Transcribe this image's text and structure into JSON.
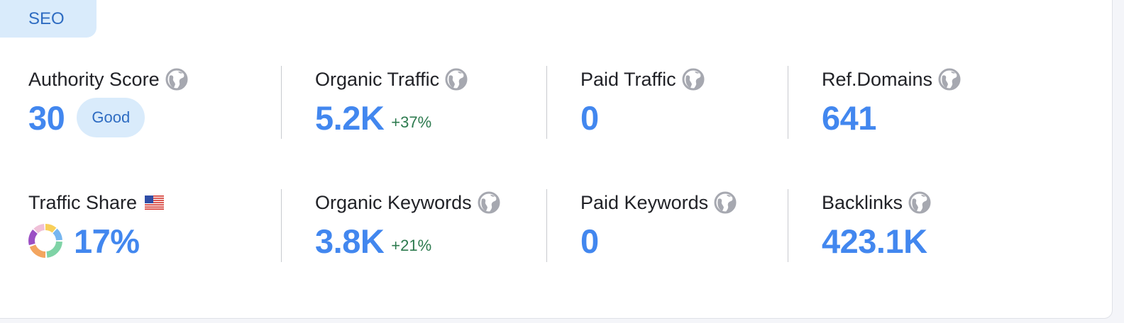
{
  "section_tab": "SEO",
  "metrics": {
    "authority_score": {
      "label": "Authority Score",
      "value": "30",
      "badge": "Good",
      "icon": "globe-icon"
    },
    "organic_traffic": {
      "label": "Organic Traffic",
      "value": "5.2K",
      "delta": "+37%",
      "icon": "globe-icon"
    },
    "paid_traffic": {
      "label": "Paid Traffic",
      "value": "0",
      "icon": "globe-icon"
    },
    "ref_domains": {
      "label": "Ref.Domains",
      "value": "641",
      "icon": "globe-icon"
    },
    "traffic_share": {
      "label": "Traffic Share",
      "value": "17%",
      "icon": "us-flag-icon"
    },
    "organic_keywords": {
      "label": "Organic Keywords",
      "value": "3.8K",
      "delta": "+21%",
      "icon": "globe-icon"
    },
    "paid_keywords": {
      "label": "Paid Keywords",
      "value": "0",
      "icon": "globe-icon"
    },
    "backlinks": {
      "label": "Backlinks",
      "value": "423.1K",
      "icon": "globe-icon"
    }
  },
  "colors": {
    "value": "#4287ef",
    "delta_positive": "#2c7a4e",
    "badge_bg": "#d9ebfb",
    "badge_text": "#2e6cc2"
  }
}
